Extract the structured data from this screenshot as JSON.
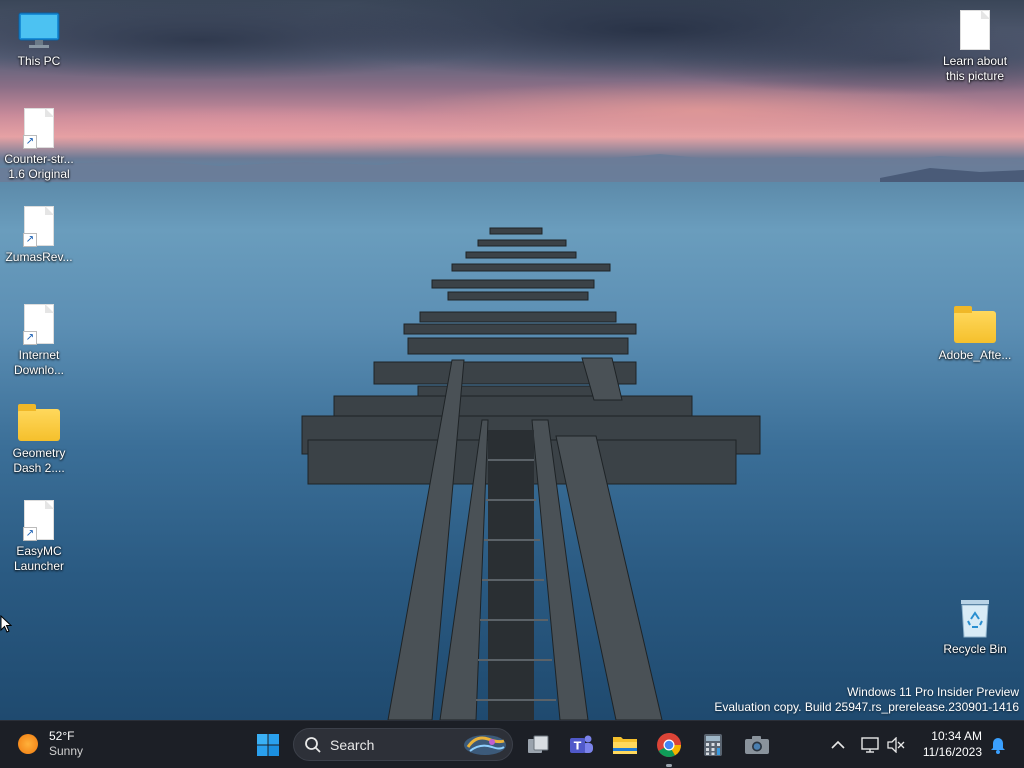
{
  "desktop": {
    "icons": [
      {
        "label": "This PC"
      },
      {
        "label": "Counter-str...\n1.6 Original"
      },
      {
        "label": "ZumasRev..."
      },
      {
        "label": "Internet\nDownlo..."
      },
      {
        "label": "Geometry\nDash 2...."
      },
      {
        "label": "EasyMC\nLauncher"
      },
      {
        "label": "Learn about\nthis picture"
      },
      {
        "label": "Adobe_Afte..."
      },
      {
        "label": "Recycle Bin"
      }
    ]
  },
  "watermark": {
    "line1": "Windows 11 Pro Insider Preview",
    "line2": "Evaluation copy. Build 25947.rs_prerelease.230901-1416"
  },
  "taskbar": {
    "weather": {
      "temp": "52°F",
      "condition": "Sunny",
      "icon": "sun-icon"
    },
    "search": {
      "label": "Search"
    },
    "apps": [
      {
        "name": "start-icon"
      },
      {
        "name": "task-view-icon"
      },
      {
        "name": "teams-icon"
      },
      {
        "name": "file-explorer-icon"
      },
      {
        "name": "chrome-icon"
      },
      {
        "name": "calculator-icon"
      },
      {
        "name": "camera-icon"
      }
    ],
    "clock": {
      "time": "10:34 AM",
      "date": "11/16/2023"
    }
  },
  "colors": {
    "taskbar_bg": "#1c1f26",
    "folder": "#f5c02c",
    "accent": "#0078d4"
  }
}
